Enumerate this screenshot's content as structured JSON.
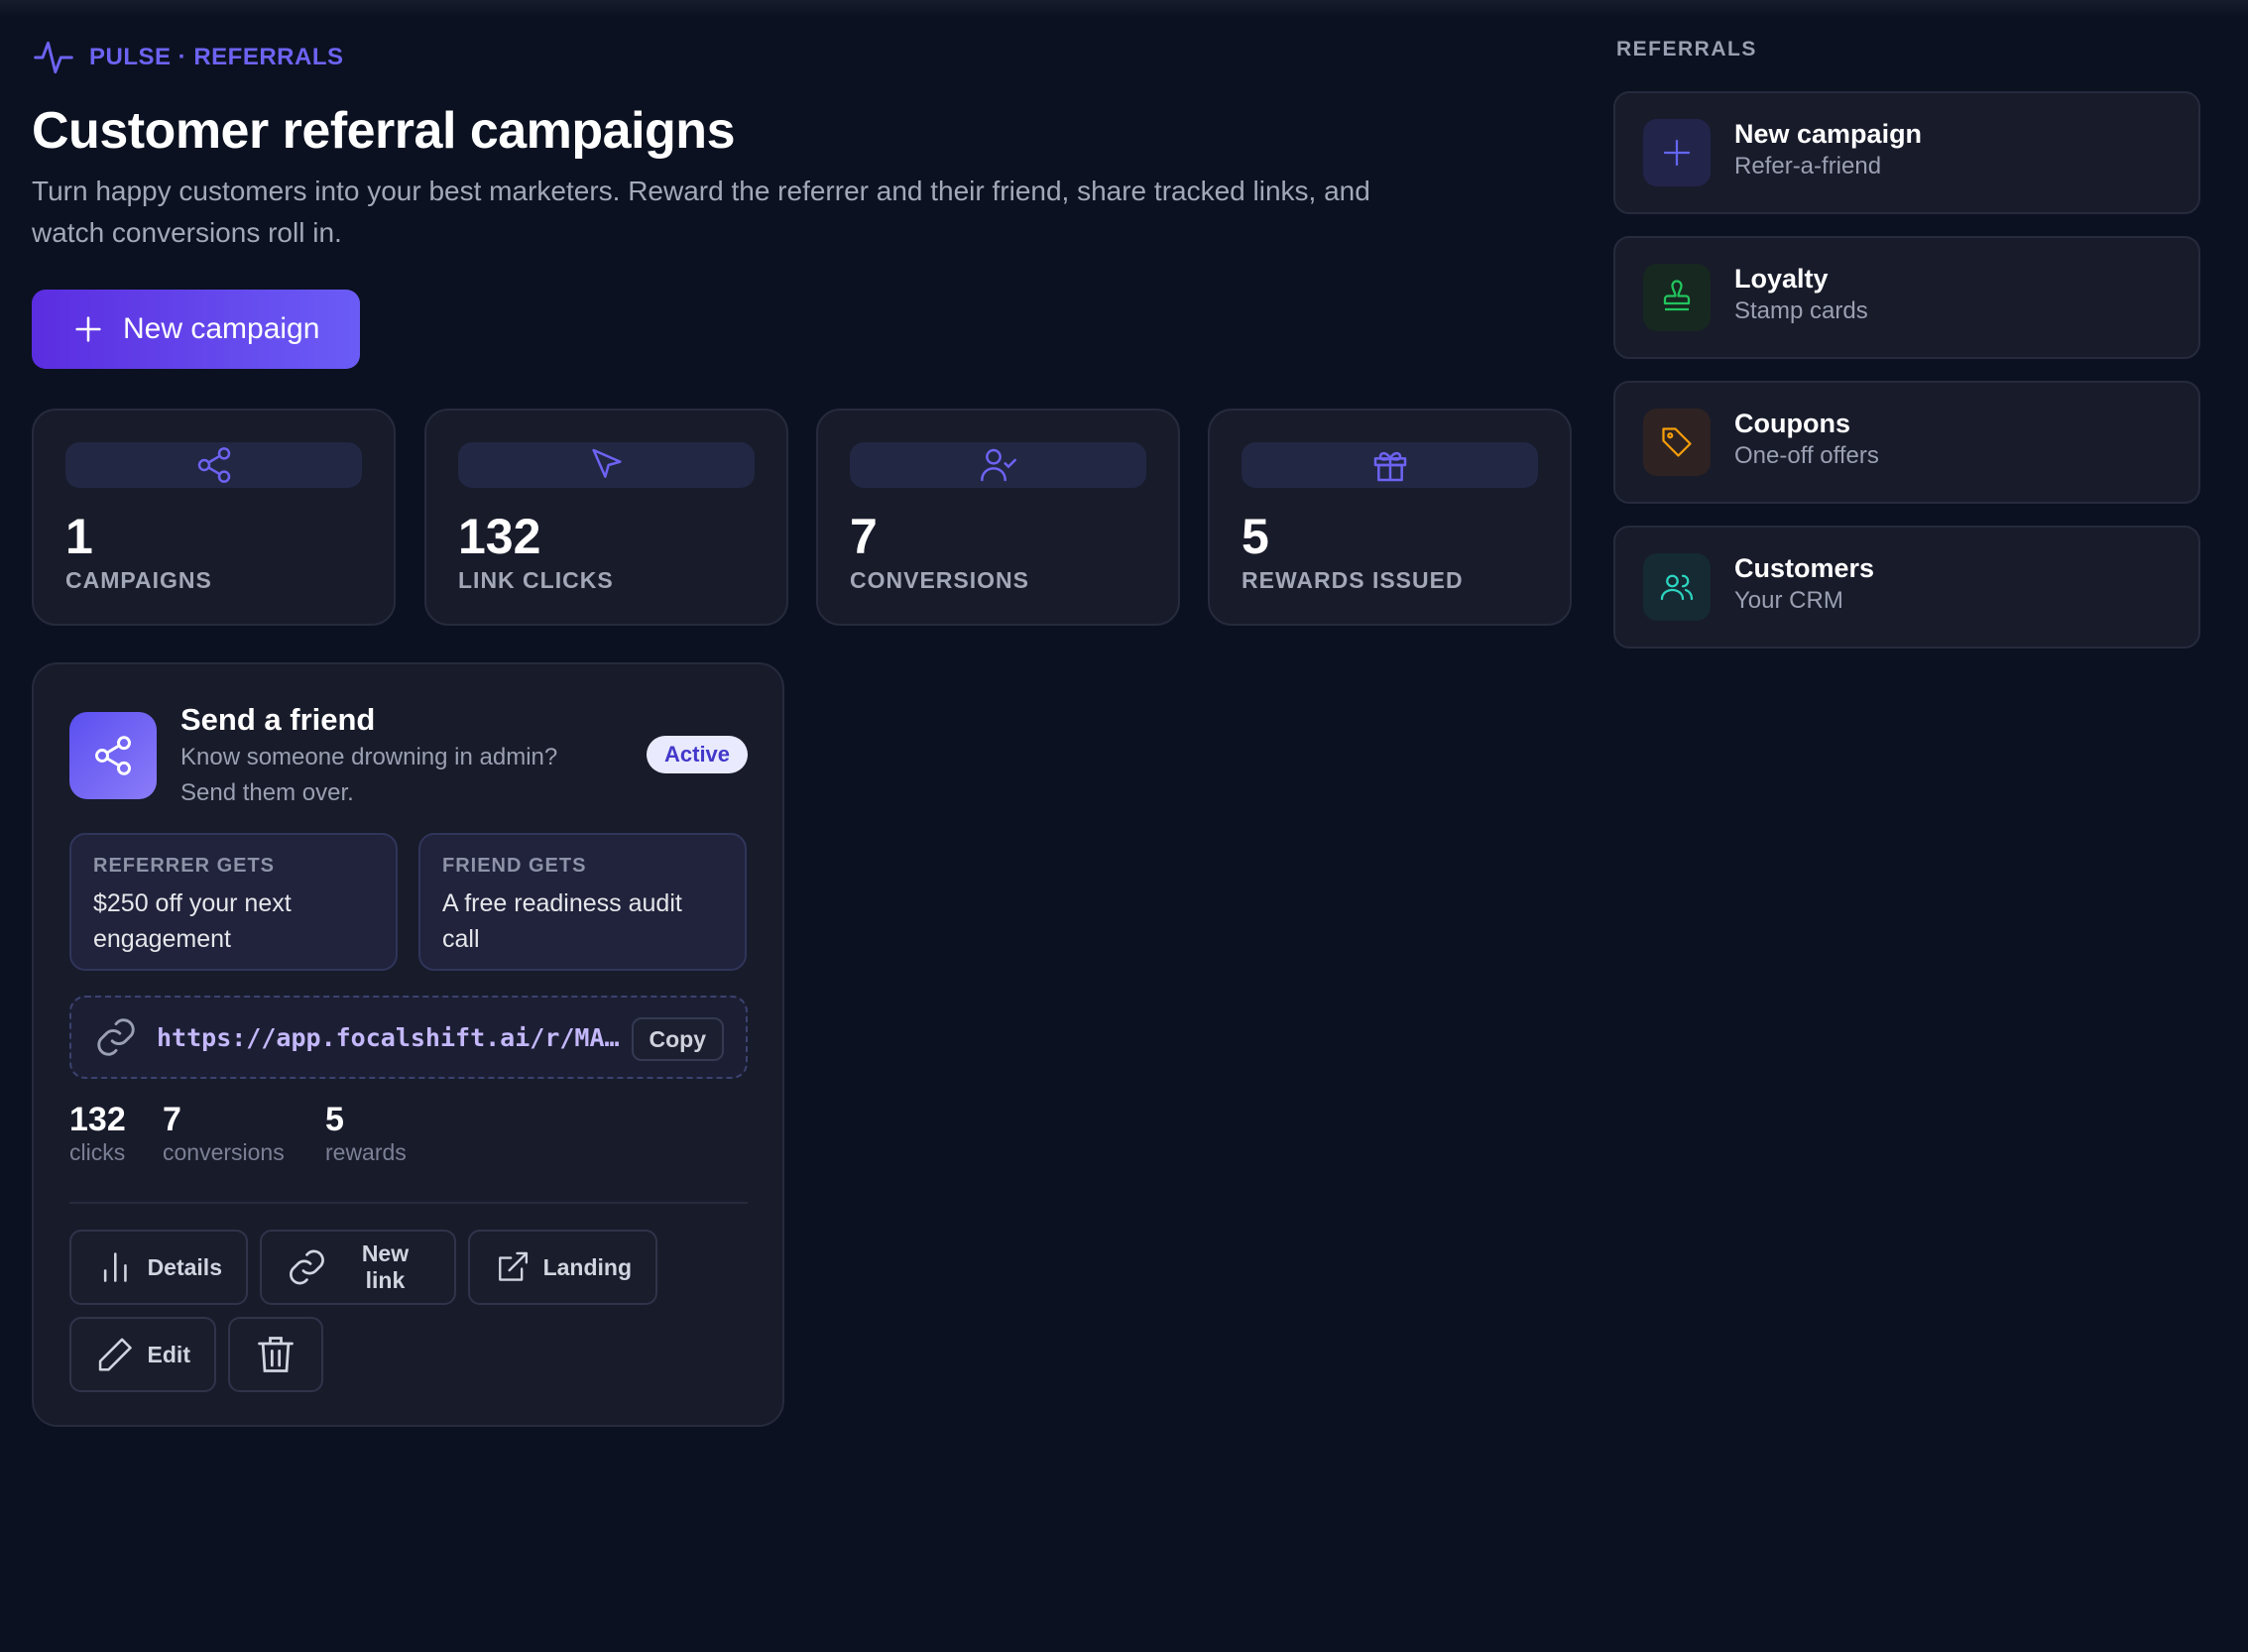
{
  "breadcrumb": "PULSE · REFERRALS",
  "page": {
    "title": "Customer referral campaigns",
    "subtitle": "Turn happy customers into your best marketers. Reward the referrer and their friend, share tracked links, and watch conversions roll in."
  },
  "new_campaign_button": "New campaign",
  "stats": [
    {
      "value": "1",
      "label": "CAMPAIGNS",
      "icon": "share-icon"
    },
    {
      "value": "132",
      "label": "LINK CLICKS",
      "icon": "cursor-icon"
    },
    {
      "value": "7",
      "label": "CONVERSIONS",
      "icon": "user-check-icon"
    },
    {
      "value": "5",
      "label": "REWARDS ISSUED",
      "icon": "gift-icon"
    }
  ],
  "campaign": {
    "name": "Send a friend",
    "description": "Know someone drowning in admin? Send them over.",
    "status": "Active",
    "referrer_label": "REFERRER GETS",
    "referrer_value": "$250 off your next engagement",
    "friend_label": "FRIEND GETS",
    "friend_value": "A free readiness audit call",
    "link": "https://app.focalshift.ai/r/MAV…",
    "copy_label": "Copy",
    "metrics": [
      {
        "value": "132",
        "label": "clicks"
      },
      {
        "value": "7",
        "label": "conversions"
      },
      {
        "value": "5",
        "label": "rewards"
      }
    ],
    "actions": {
      "details": "Details",
      "new_link": "New link",
      "landing": "Landing",
      "edit": "Edit"
    }
  },
  "sidebar": {
    "heading": "REFERRALS",
    "items": [
      {
        "title": "New campaign",
        "subtitle": "Refer-a-friend",
        "icon": "plus-icon",
        "color": "#6366f1"
      },
      {
        "title": "Loyalty",
        "subtitle": "Stamp cards",
        "icon": "stamp-icon",
        "color": "#22c55e"
      },
      {
        "title": "Coupons",
        "subtitle": "One-off offers",
        "icon": "tag-icon",
        "color": "#f59e0b"
      },
      {
        "title": "Customers",
        "subtitle": "Your CRM",
        "icon": "users-icon",
        "color": "#2dd4bf"
      }
    ]
  },
  "colors": {
    "background": "#0b1120",
    "card": "#181b2a",
    "accent": "#6366f1",
    "primary_gradient_start": "#5b2de0",
    "primary_gradient_end": "#6b5cf6"
  }
}
